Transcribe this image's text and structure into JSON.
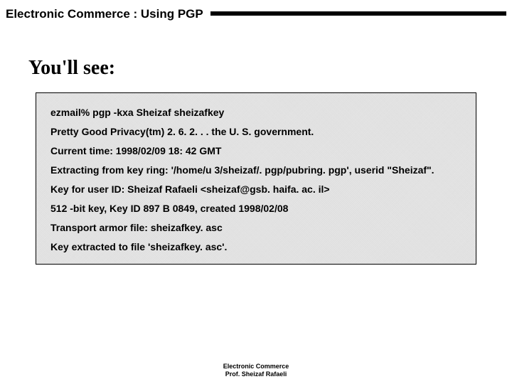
{
  "header": {
    "title": "Electronic Commerce :  Using PGP"
  },
  "subhead": "You'll see:",
  "terminal": {
    "lines": [
      "ezmail% pgp -kxa Sheizaf  sheizafkey",
      "Pretty Good Privacy(tm) 2. 6. 2. . . the U. S. government.",
      "Current time: 1998/02/09 18: 42 GMT",
      "Extracting from key ring: '/home/u 3/sheizaf/. pgp/pubring. pgp', userid \"Sheizaf\".",
      "Key for user ID: Sheizaf Rafaeli <sheizaf@gsb. haifa. ac. il>",
      "512 -bit key, Key ID 897 B 0849, created 1998/02/08",
      "Transport armor file: sheizafkey. asc",
      "Key extracted to file 'sheizafkey. asc'."
    ]
  },
  "footer": {
    "line1": "Electronic Commerce",
    "line2": "Prof. Sheizaf Rafaeli"
  }
}
